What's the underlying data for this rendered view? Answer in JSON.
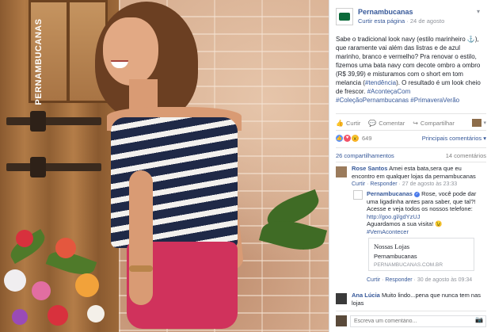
{
  "photo": {
    "brand_vertical": "PERNAMBUCANAS"
  },
  "post": {
    "page_name": "Pernambucanas",
    "follow_label": "Curtir esta página",
    "date": "24 de agosto",
    "text_main": "Sabe o tradicional look navy (estilo marinheiro ⚓), que raramente vai além das listras e de azul marinho, branco e vermelho? Pra renovar o estilo, fizemos uma bata navy com decote ombro a ombro (R$ 39,99) e misturamos com o short em tom melancia (",
    "text_hashtag1": "#tendência",
    "text_tail": "). O resultado é um look cheio de frescor. ",
    "text_hashtag2": "#AconteçaCom",
    "text_hashtag3": "#ColeçãoPernambucanas #PrimaveraVerão"
  },
  "actions": {
    "like": "Curtir",
    "comment": "Comentar",
    "share": "Compartilhar"
  },
  "reactions": {
    "count": "649",
    "sort_label": "Principais comentários"
  },
  "stats": {
    "shares": "26 compartilhamentos",
    "comments": "14 comentários"
  },
  "comments": [
    {
      "name": "Rose Santos",
      "text": "Amei esta bata,sera que eu encontro em qualquer lojas da pernambucanas",
      "like": "Curtir",
      "reply": "Responder",
      "time": "27 de agosto às 23:33"
    },
    {
      "name": "Pernambucanas",
      "text": "Rose, você pode dar uma ligadinha antes para saber, que tal?! Acesse e veja todos os nossos telefone: ",
      "link": "http://goo.gl/gdYzUJ",
      "text2": "Aguardamos a sua visita! 😉",
      "hashtag": "#VemAcontecer",
      "like": "Curtir",
      "reply": "Responder",
      "time": "30 de agosto às 09:34"
    },
    {
      "name": "Ana Lúcia",
      "text": "Muito lindo...pena que nunca tem nas lojas"
    }
  ],
  "link_card": {
    "title": "Nossas Lojas",
    "subtitle": "Pernambucanas",
    "url": "PERNAMBUCANAS.COM.BR"
  },
  "composer": {
    "placeholder": "Escreva um comentário..."
  }
}
